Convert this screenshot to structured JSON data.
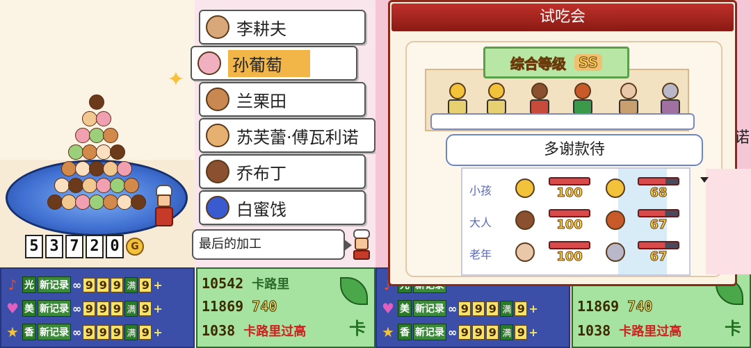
{
  "left": {
    "money_digits": [
      "5",
      "3",
      "7",
      "2",
      "0"
    ],
    "coin_symbol": "G",
    "menu": [
      {
        "name": "李耕夫",
        "avatar_color": "#d9a87a"
      },
      {
        "name": "孙葡萄",
        "avatar_color": "#f0b0c0",
        "selected": true
      },
      {
        "name": "兰栗田",
        "avatar_color": "#c88850"
      },
      {
        "name": "苏芙蕾·傅瓦利诺",
        "avatar_color": "#e6b070"
      },
      {
        "name": "乔布丁",
        "avatar_color": "#8a5030"
      },
      {
        "name": "白蜜饯",
        "avatar_color": "#3a5ad0"
      }
    ],
    "tooltip": "最后的加工",
    "stats": [
      {
        "icon": "♪",
        "tag": "光",
        "new": "新记录",
        "inf": "∞",
        "digits": [
          "9",
          "9",
          "9"
        ],
        "full": "满",
        "last": "9",
        "plus": "+"
      },
      {
        "icon": "♥",
        "tag": "美",
        "new": "新记录",
        "inf": "∞",
        "digits": [
          "9",
          "9",
          "9"
        ],
        "full": "满",
        "last": "9",
        "plus": "+"
      },
      {
        "icon": "★",
        "tag": "香",
        "new": "新记录",
        "inf": "∞",
        "digits": [
          "9",
          "9",
          "9"
        ],
        "full": "满",
        "last": "9",
        "plus": "+"
      }
    ],
    "info": {
      "line1": "10542",
      "line1_suffix": "卡路里",
      "line2": "11869",
      "line2_suffix": "740",
      "line3": "1038",
      "line3_suffix": "卡路里过高",
      "knife": "卡"
    }
  },
  "right": {
    "dialog_title": "试吃会",
    "rank_label": "综合等级",
    "rank_grade": "SS",
    "speech": "多谢款待",
    "edge_name": "诺",
    "rows": [
      {
        "label": "小孩",
        "score_a": "100",
        "score_b": "68",
        "fill_b": 0.68
      },
      {
        "label": "大人",
        "score_a": "100",
        "score_b": "67",
        "fill_b": 0.67
      },
      {
        "label": "老年",
        "score_a": "100",
        "score_b": "67",
        "fill_b": 0.67
      }
    ]
  },
  "colors": {
    "accent_red": "#c0302a",
    "panel_blue": "#3c4fa8",
    "panel_green": "#a7e3a0"
  }
}
